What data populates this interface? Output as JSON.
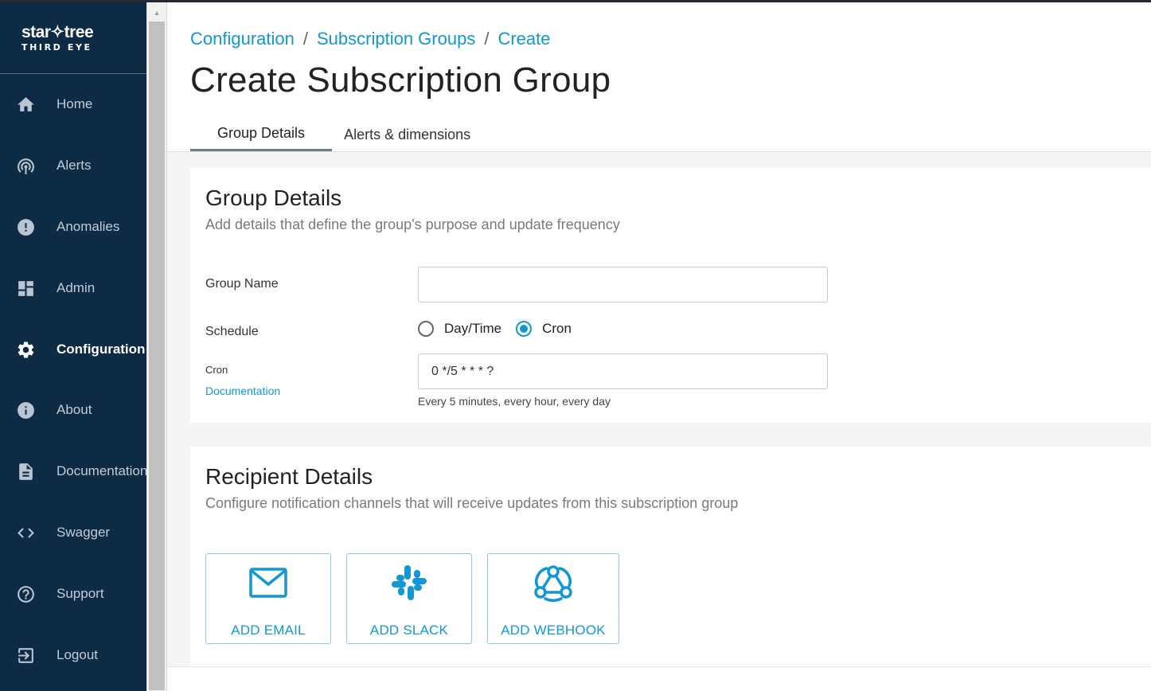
{
  "brand": {
    "name": "star✧tree",
    "product": "THIRD EYE"
  },
  "sidebar": {
    "items": [
      {
        "label": "Home",
        "icon": "home-icon"
      },
      {
        "label": "Alerts",
        "icon": "alerts-icon"
      },
      {
        "label": "Anomalies",
        "icon": "anomalies-icon"
      },
      {
        "label": "Admin",
        "icon": "admin-icon"
      },
      {
        "label": "Configuration",
        "icon": "gear-icon",
        "active": true
      },
      {
        "label": "About",
        "icon": "info-icon"
      },
      {
        "label": "Documentation",
        "icon": "document-icon"
      },
      {
        "label": "Swagger",
        "icon": "code-icon"
      },
      {
        "label": "Support",
        "icon": "help-icon"
      },
      {
        "label": "Logout",
        "icon": "logout-icon"
      }
    ]
  },
  "breadcrumb": [
    {
      "label": "Configuration"
    },
    {
      "label": "Subscription Groups"
    },
    {
      "label": "Create"
    }
  ],
  "page": {
    "title": "Create Subscription Group"
  },
  "tabs": [
    {
      "label": "Group Details",
      "active": true
    },
    {
      "label": "Alerts & dimensions",
      "active": false
    }
  ],
  "group_details": {
    "title": "Group Details",
    "subtitle": "Add details that define the group's purpose and update frequency",
    "name_label": "Group Name",
    "name_value": "",
    "schedule_label": "Schedule",
    "schedule_options": [
      {
        "label": "Day/Time",
        "checked": false
      },
      {
        "label": "Cron",
        "checked": true
      }
    ],
    "cron_label": "Cron",
    "cron_doc_link": "Documentation",
    "cron_value": "0 */5 * * * ?",
    "cron_helper": "Every 5 minutes, every hour, every day"
  },
  "recipient_details": {
    "title": "Recipient Details",
    "subtitle": "Configure notification channels that will receive updates from this subscription group",
    "channels": [
      {
        "label": "ADD EMAIL",
        "icon": "mail-icon"
      },
      {
        "label": "ADD SLACK",
        "icon": "slack-icon"
      },
      {
        "label": "ADD WEBHOOK",
        "icon": "webhook-icon"
      }
    ]
  },
  "colors": {
    "sidebar_bg": "#0d2b45",
    "accent": "#1297d3",
    "page_bg": "#f5f5f5"
  }
}
